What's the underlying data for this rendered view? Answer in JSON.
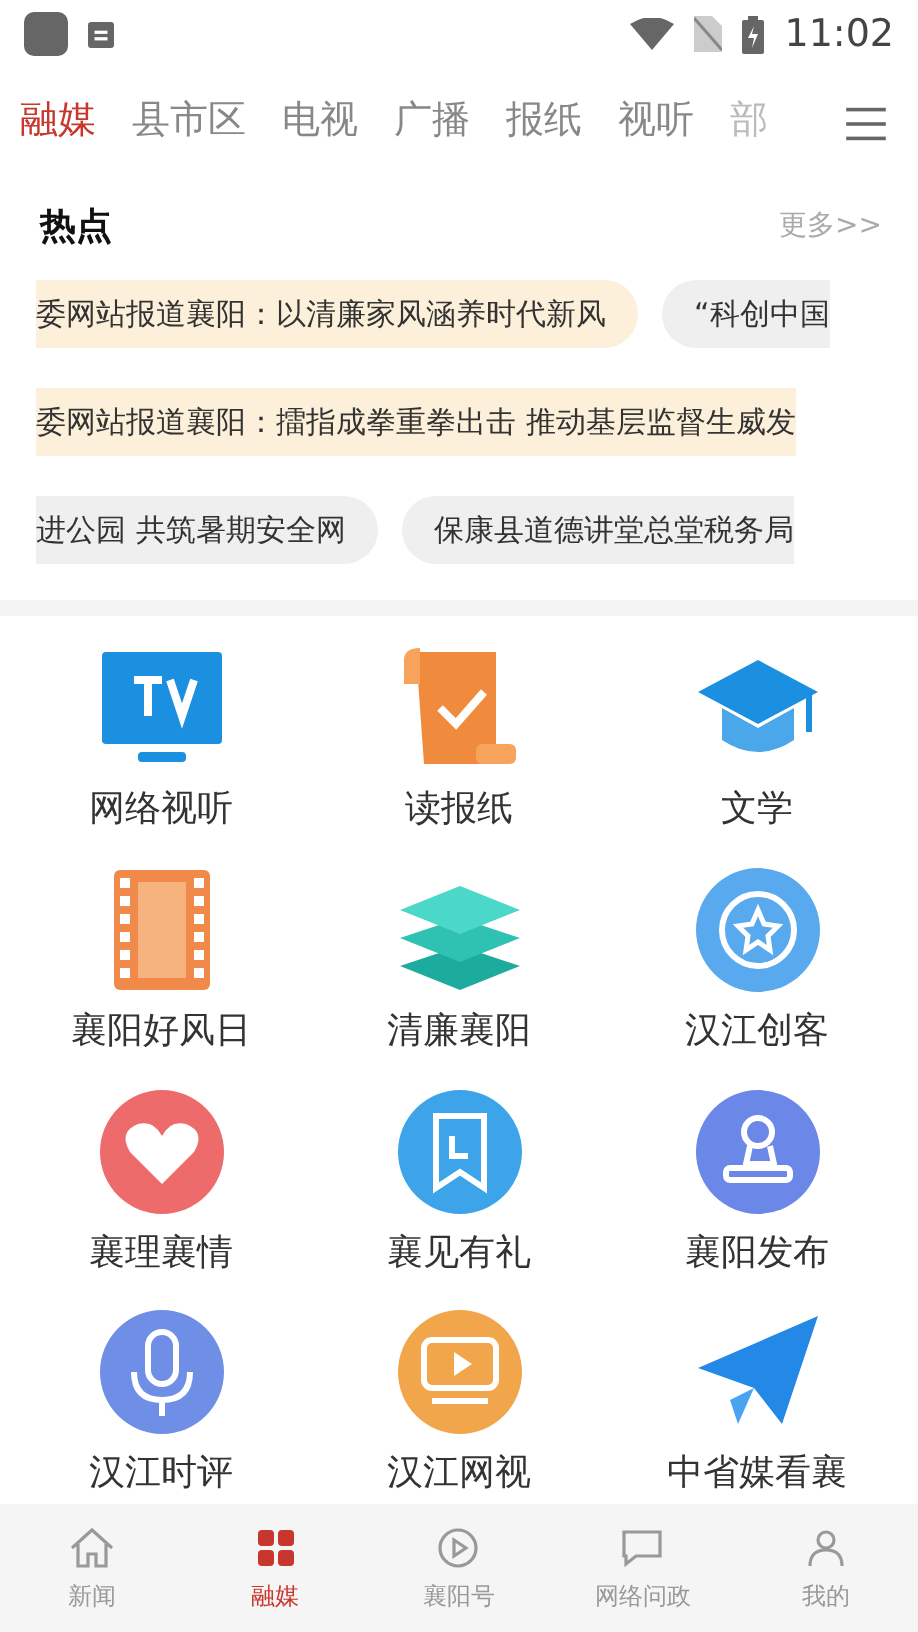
{
  "status_bar": {
    "time": "11:02"
  },
  "tabs": [
    {
      "label": "融媒",
      "selected": true
    },
    {
      "label": "县市区",
      "selected": false
    },
    {
      "label": "电视",
      "selected": false
    },
    {
      "label": "广播",
      "selected": false
    },
    {
      "label": "报纸",
      "selected": false
    },
    {
      "label": "视听",
      "selected": false
    },
    {
      "label": "部",
      "selected": false
    }
  ],
  "hot": {
    "title": "热点",
    "more": "更多>>",
    "rows": [
      [
        {
          "text": "委网站报道襄阳：以清廉家风涵养时代新风",
          "highlighted": true
        },
        {
          "text": "“科创中国",
          "highlighted": false
        }
      ],
      [
        {
          "text": "委网站报道襄阳：擂指成拳重拳出击 推动基层监督生威发",
          "highlighted": true
        }
      ],
      [
        {
          "text": "进公园 共筑暑期安全网",
          "highlighted": false
        },
        {
          "text": "保康县道德讲堂总堂税务局",
          "highlighted": false
        }
      ]
    ]
  },
  "grid": [
    {
      "label": "网络视听",
      "kind": "tv"
    },
    {
      "label": "读报纸",
      "kind": "scroll"
    },
    {
      "label": "文学",
      "kind": "cap"
    },
    {
      "label": "襄阳好风日",
      "kind": "film"
    },
    {
      "label": "清廉襄阳",
      "kind": "layers"
    },
    {
      "label": "汉江创客",
      "kind": "star"
    },
    {
      "label": "襄理襄情",
      "kind": "heart"
    },
    {
      "label": "襄见有礼",
      "kind": "bookmark"
    },
    {
      "label": "襄阳发布",
      "kind": "stamp"
    },
    {
      "label": "汉江时评",
      "kind": "mic"
    },
    {
      "label": "汉江网视",
      "kind": "video"
    },
    {
      "label": "中省媒看襄",
      "kind": "plane"
    }
  ],
  "bottom_nav": [
    {
      "label": "新闻",
      "selected": false
    },
    {
      "label": "融媒",
      "selected": true
    },
    {
      "label": "襄阳号",
      "selected": false
    },
    {
      "label": "网络问政",
      "selected": false
    },
    {
      "label": "我的",
      "selected": false
    }
  ]
}
